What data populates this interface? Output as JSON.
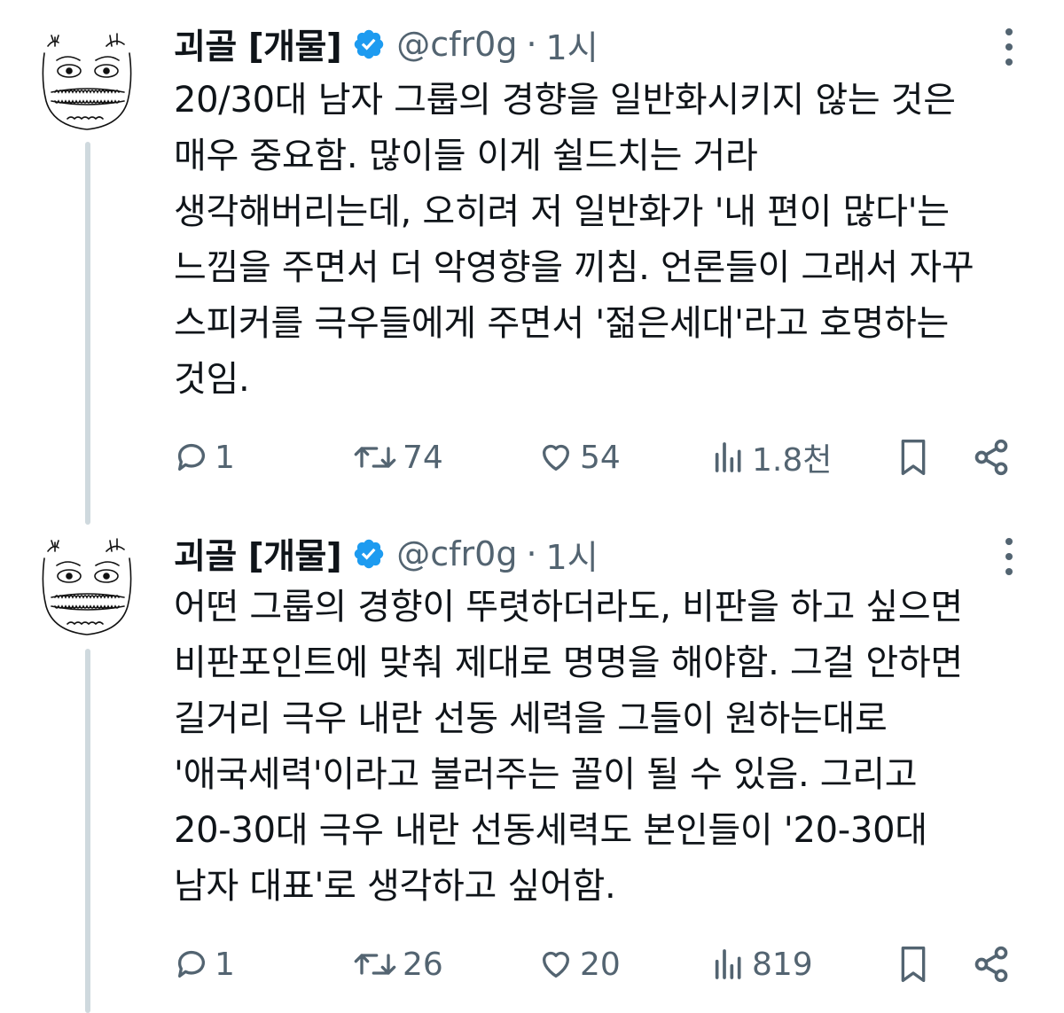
{
  "tweets": [
    {
      "author_name": "괴골 [개물]",
      "handle": "@cfr0g",
      "separator": "·",
      "time": "1시",
      "body": "20/30대 남자 그룹의 경향을 일반화시키지 않는 것은\n매우 중요함. 많이들 이게 쉴드치는 거라\n생각해버리는데, 오히려 저 일반화가 '내 편이 많다'는\n느낌을 주면서 더 악영향을 끼침. 언론들이 그래서 자꾸\n스피커를 극우들에게 주면서 '젊은세대'라고 호명하는\n것임.",
      "replies": "1",
      "retweets": "74",
      "likes": "54",
      "views": "1.8천"
    },
    {
      "author_name": "괴골 [개물]",
      "handle": "@cfr0g",
      "separator": "·",
      "time": "1시",
      "body": "어떤 그룹의 경향이 뚜렷하더라도, 비판을 하고 싶으면\n비판포인트에 맞춰 제대로 명명을 해야함. 그걸 안하면\n길거리 극우 내란 선동 세력을 그들이 원하는대로\n'애국세력'이라고 불러주는 꼴이 될 수 있음. 그리고\n20-30대 극우 내란 선동세력도 본인들이 '20-30대\n남자 대표'로 생각하고 싶어함.",
      "replies": "1",
      "retweets": "26",
      "likes": "20",
      "views": "819"
    }
  ],
  "icons": {
    "verified": "verified-badge-icon",
    "more": "more-vertical-icon",
    "reply": "reply-icon",
    "retweet": "retweet-icon",
    "like": "heart-icon",
    "views": "views-bar-chart-icon",
    "bookmark": "bookmark-icon",
    "share": "share-icon"
  },
  "colors": {
    "verified_blue": "#1d9bf0",
    "secondary_text": "#536471",
    "thread_line": "#cfd9de"
  }
}
